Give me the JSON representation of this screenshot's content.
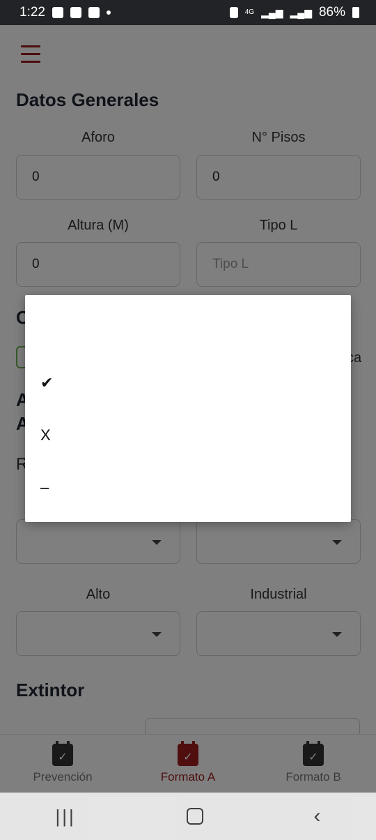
{
  "status_bar": {
    "time": "1:22",
    "network": "4G",
    "battery": "86%"
  },
  "app": {
    "sections": {
      "datos_generales": "Datos Generales",
      "extintor": "Extintor"
    },
    "fields": {
      "aforo": {
        "label": "Aforo",
        "value": "0"
      },
      "pisos": {
        "label": "N° Pisos",
        "value": "0"
      },
      "altura": {
        "label": "Altura (M)",
        "value": "0"
      },
      "tipo_l": {
        "label": "Tipo L",
        "placeholder": "Tipo L"
      }
    },
    "selects": {
      "alto": {
        "label": "Alto",
        "value": ""
      },
      "industrial": {
        "label": "Industrial",
        "value": ""
      }
    },
    "partial_text": {
      "c": "C",
      "a1": "A",
      "a2": "A",
      "r": "R",
      "ca": "ca"
    }
  },
  "dialog": {
    "options": [
      "✔",
      "X",
      "–"
    ]
  },
  "bottom_nav": {
    "items": [
      {
        "label": "Prevención",
        "icon": "calendar-check-icon",
        "active": false
      },
      {
        "label": "Formato A",
        "icon": "calendar-check-icon",
        "active": true
      },
      {
        "label": "Formato B",
        "icon": "calendar-check-icon",
        "active": false
      }
    ]
  },
  "colors": {
    "accent": "#9b1b1b",
    "overlay": "rgba(0,0,0,0.5)"
  }
}
